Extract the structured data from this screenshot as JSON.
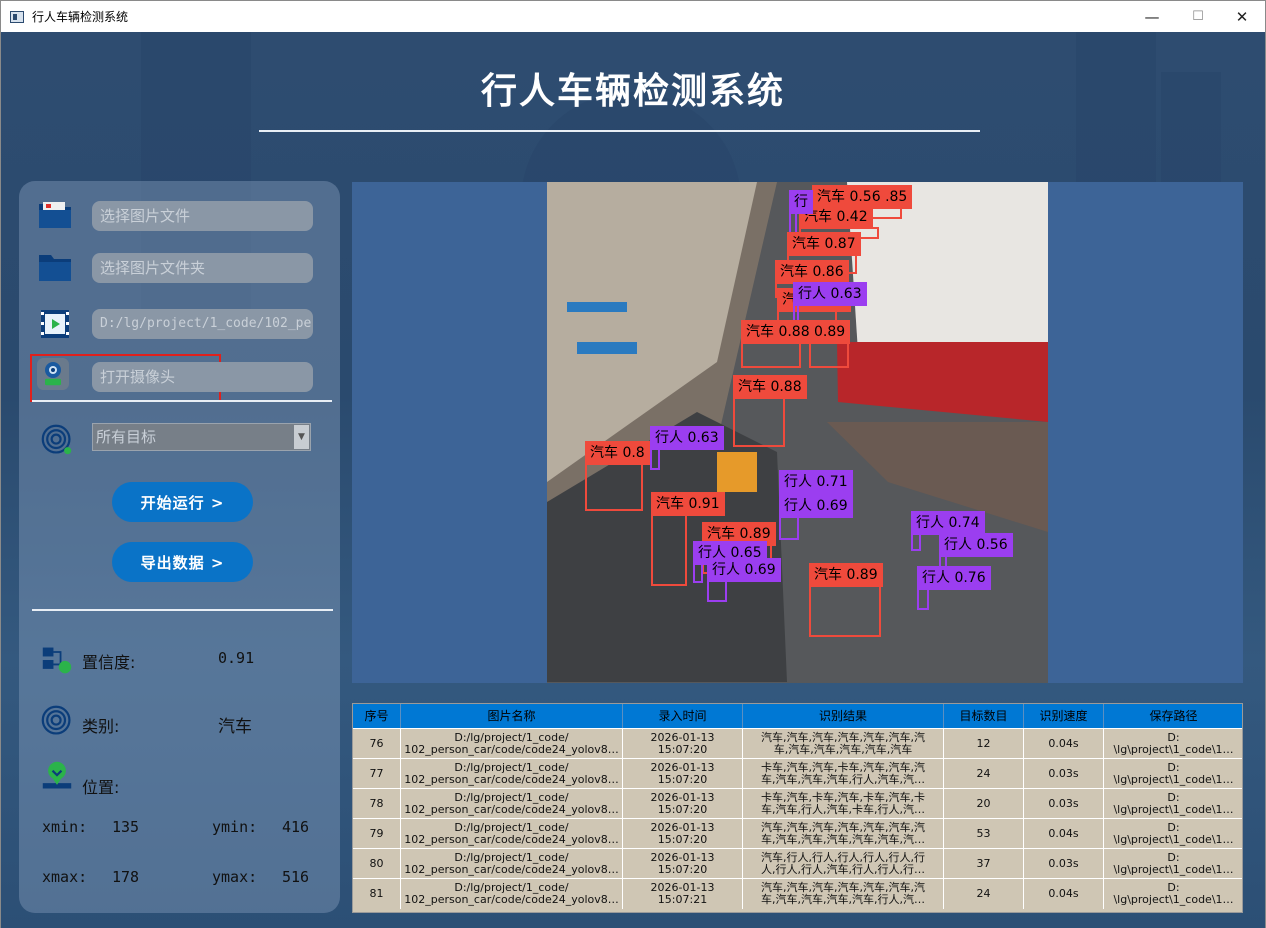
{
  "window": {
    "title": "行人车辆检测系统",
    "minimize": "—",
    "maximize": "☐",
    "close": "✕"
  },
  "header": {
    "title": "行人车辆检测系统"
  },
  "left_panel": {
    "image_file_placeholder": "选择图片文件",
    "image_folder_placeholder": "选择图片文件夹",
    "video_path": "D:/lg/project/1_code/102_pe",
    "camera_placeholder": "打开摄像头",
    "target_select": "所有目标",
    "start_button": "开始运行 >",
    "export_button": "导出数据 >",
    "confidence_label": "置信度:",
    "confidence_value": "0.91",
    "class_label": "类别:",
    "class_value": "汽车",
    "position_label": "位置:",
    "xmin_label": "xmin:",
    "xmin_value": "135",
    "ymin_label": "ymin:",
    "ymin_value": "416",
    "xmax_label": "xmax:",
    "xmax_value": "178",
    "ymax_label": "ymax:",
    "ymax_value": "516"
  },
  "detections": [
    {
      "label": "汽车 0.56 .85",
      "kind": "car"
    },
    {
      "label": "汽车 0.42",
      "kind": "car"
    },
    {
      "label": "行",
      "kind": "ped"
    },
    {
      "label": "汽车 0.87",
      "kind": "car"
    },
    {
      "label": "汽车 0.86",
      "kind": "car"
    },
    {
      "label": "汽车 0.86",
      "kind": "car"
    },
    {
      "label": "行人 0.63",
      "kind": "ped"
    },
    {
      "label": "汽车 0.88",
      "kind": "car"
    },
    {
      "label": "0.89",
      "kind": "car"
    },
    {
      "label": "汽车 0.88",
      "kind": "car"
    },
    {
      "label": "汽车 0.8",
      "kind": "car"
    },
    {
      "label": "行人 0.63",
      "kind": "ped"
    },
    {
      "label": "汽车 0.91",
      "kind": "car"
    },
    {
      "label": "行人 0.71",
      "kind": "ped"
    },
    {
      "label": "行人 0.69",
      "kind": "ped"
    },
    {
      "label": "汽车 0.89",
      "kind": "car"
    },
    {
      "label": "行人 0.65",
      "kind": "ped"
    },
    {
      "label": "行人 0.69",
      "kind": "ped"
    },
    {
      "label": "汽车 0.89",
      "kind": "car"
    },
    {
      "label": "行人 0.74",
      "kind": "ped"
    },
    {
      "label": "行人 0.56",
      "kind": "ped"
    },
    {
      "label": "行人 0.76",
      "kind": "ped"
    }
  ],
  "table": {
    "headers": [
      "序号",
      "图片名称",
      "录入时间",
      "识别结果",
      "目标数目",
      "识别速度",
      "保存路径"
    ],
    "rows": [
      [
        "76",
        "D:/lg/project/1_code/\n102_person_car/code/code24_yolov8…",
        "2026-01-13\n15:07:20",
        "汽车,汽车,汽车,汽车,汽车,汽车,汽\n车,汽车,汽车,汽车,汽车,汽车",
        "12",
        "0.04s",
        "D:\n\\lg\\project\\1_code\\1…"
      ],
      [
        "77",
        "D:/lg/project/1_code/\n102_person_car/code/code24_yolov8…",
        "2026-01-13\n15:07:20",
        "卡车,汽车,汽车,卡车,汽车,汽车,汽\n车,汽车,汽车,汽车,行人,汽车,汽…",
        "24",
        "0.03s",
        "D:\n\\lg\\project\\1_code\\1…"
      ],
      [
        "78",
        "D:/lg/project/1_code/\n102_person_car/code/code24_yolov8…",
        "2026-01-13\n15:07:20",
        "卡车,汽车,卡车,汽车,卡车,汽车,卡\n车,汽车,行人,汽车,卡车,行人,汽…",
        "20",
        "0.03s",
        "D:\n\\lg\\project\\1_code\\1…"
      ],
      [
        "79",
        "D:/lg/project/1_code/\n102_person_car/code/code24_yolov8…",
        "2026-01-13\n15:07:20",
        "汽车,汽车,汽车,汽车,汽车,汽车,汽\n车,汽车,汽车,汽车,汽车,汽车,汽…",
        "53",
        "0.04s",
        "D:\n\\lg\\project\\1_code\\1…"
      ],
      [
        "80",
        "D:/lg/project/1_code/\n102_person_car/code/code24_yolov8…",
        "2026-01-13\n15:07:20",
        "汽车,行人,行人,行人,行人,行人,行\n人,行人,行人,汽车,行人,行人,行…",
        "37",
        "0.03s",
        "D:\n\\lg\\project\\1_code\\1…"
      ],
      [
        "81",
        "D:/lg/project/1_code/\n102_person_car/code/code24_yolov8…",
        "2026-01-13\n15:07:21",
        "汽车,汽车,汽车,汽车,汽车,汽车,汽\n车,汽车,汽车,汽车,汽车,行人,汽…",
        "24",
        "0.04s",
        "D:\n\\lg\\project\\1_code\\1…"
      ]
    ]
  },
  "colors": {
    "car_box": "#ef4a3c",
    "person_box": "#9b3ef0",
    "button": "#0a73c7",
    "table_header": "#0078d4",
    "viewer_bg": "#3d6497"
  }
}
